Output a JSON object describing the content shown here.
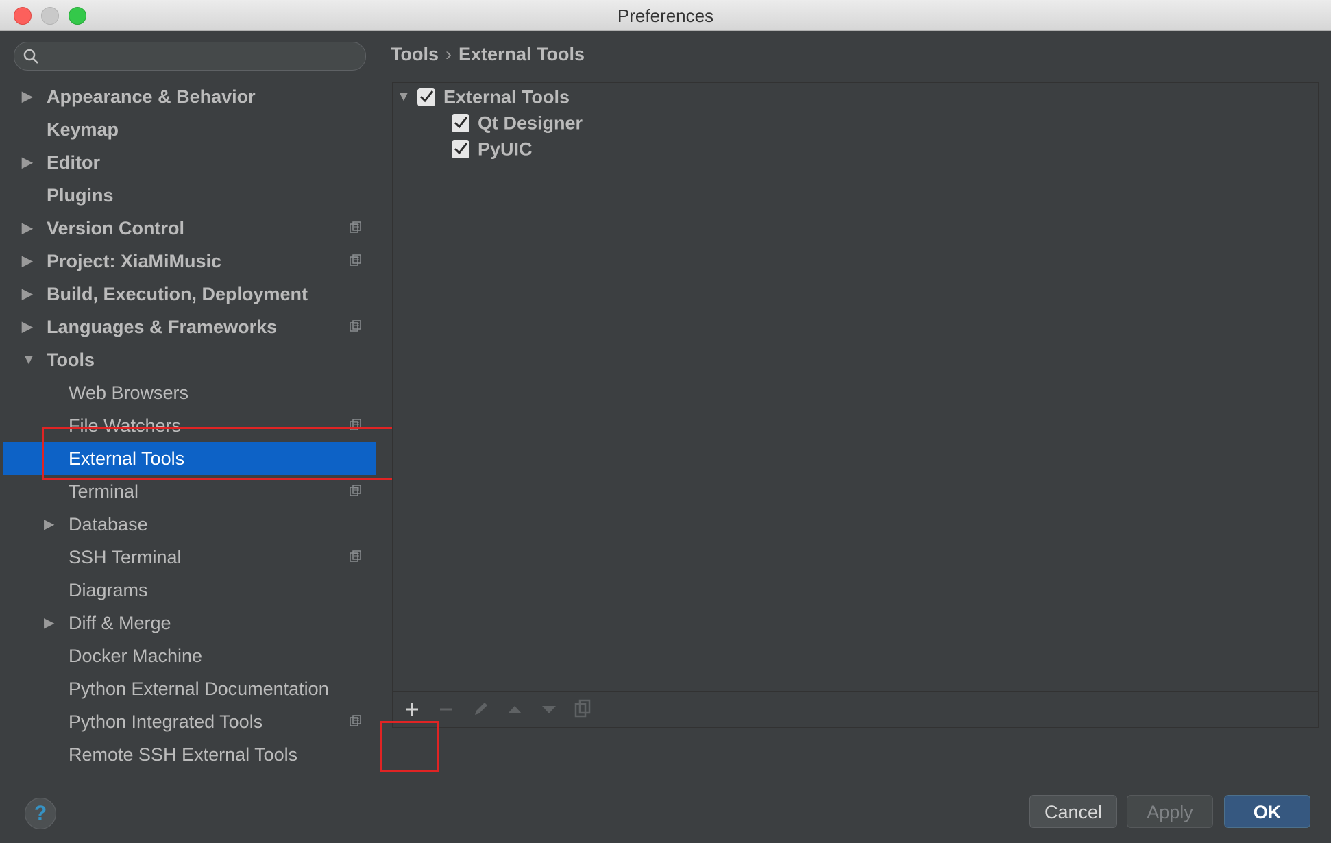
{
  "window": {
    "title": "Preferences"
  },
  "search": {
    "placeholder": ""
  },
  "sidebar": {
    "items": [
      {
        "label": "Appearance & Behavior",
        "expandable": true,
        "expanded": false
      },
      {
        "label": "Keymap"
      },
      {
        "label": "Editor",
        "expandable": true,
        "expanded": false
      },
      {
        "label": "Plugins"
      },
      {
        "label": "Version Control",
        "expandable": true,
        "expanded": false,
        "project_icon": true
      },
      {
        "label": "Project: XiaMiMusic",
        "expandable": true,
        "expanded": false,
        "project_icon": true
      },
      {
        "label": "Build, Execution, Deployment",
        "expandable": true,
        "expanded": false
      },
      {
        "label": "Languages & Frameworks",
        "expandable": true,
        "expanded": false,
        "project_icon": true
      },
      {
        "label": "Tools",
        "expandable": true,
        "expanded": true
      },
      {
        "label": "Web Browsers"
      },
      {
        "label": "File Watchers",
        "project_icon": true
      },
      {
        "label": "External Tools",
        "selected": true
      },
      {
        "label": "Terminal",
        "project_icon": true
      },
      {
        "label": "Database",
        "expandable": true,
        "expanded": false
      },
      {
        "label": "SSH Terminal",
        "project_icon": true
      },
      {
        "label": "Diagrams"
      },
      {
        "label": "Diff & Merge",
        "expandable": true,
        "expanded": false
      },
      {
        "label": "Docker Machine"
      },
      {
        "label": "Python External Documentation"
      },
      {
        "label": "Python Integrated Tools",
        "project_icon": true
      },
      {
        "label": "Remote SSH External Tools"
      }
    ]
  },
  "breadcrumb": {
    "parent": "Tools",
    "separator": "›",
    "current": "External Tools"
  },
  "tools_tree": {
    "group": {
      "label": "External Tools",
      "checked": true,
      "expanded": true
    },
    "children": [
      {
        "label": "Qt Designer",
        "checked": true
      },
      {
        "label": "PyUIC",
        "checked": true
      }
    ]
  },
  "toolbar": {
    "buttons": [
      "add-icon",
      "remove-icon",
      "edit-icon",
      "move-up-icon",
      "move-down-icon",
      "copy-icon"
    ]
  },
  "footer": {
    "help_label": "?",
    "cancel_label": "Cancel",
    "apply_label": "Apply",
    "ok_label": "OK"
  },
  "colors": {
    "background": "#3c3f41",
    "selection": "#0d62c6",
    "highlight_box": "#e02424",
    "ok_button": "#365880"
  }
}
